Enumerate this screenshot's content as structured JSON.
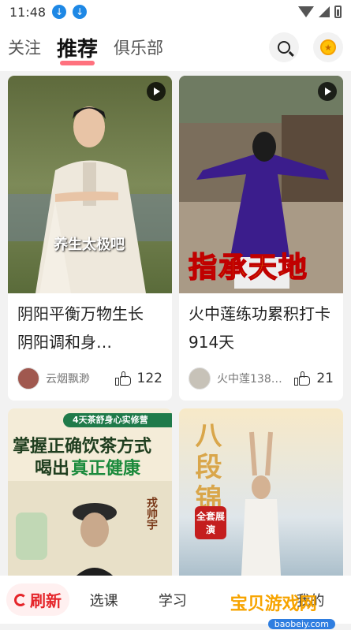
{
  "status_bar": {
    "time": "11:48"
  },
  "header": {
    "tabs": [
      {
        "label": "关注"
      },
      {
        "label": "推荐"
      },
      {
        "label": "俱乐部"
      }
    ]
  },
  "feed": {
    "cards": [
      {
        "title": "阴阳平衡万物生长 阴阳调和身…",
        "overlay": "养生太极吧",
        "author": "云烟飘渺",
        "likes": "122"
      },
      {
        "title": "火中莲练功累积打卡914天",
        "overlay": "指承天地",
        "author": "火中莲138…",
        "likes": "21"
      },
      {
        "overlay_top": "4天茶舒身心实修营",
        "overlay_line1": "掌握正确饮茶方式",
        "overlay_line2a": "喝出",
        "overlay_line2b": "真正健康",
        "overlay_name": "戎帅宇"
      },
      {
        "overlay_big": "八段锦",
        "overlay_badge": "全套展演"
      }
    ]
  },
  "bottom_nav": {
    "refresh": "刷新",
    "courses": "选课",
    "study": "学习",
    "mine": "我的"
  },
  "watermark": {
    "main": "宝贝游戏网",
    "sub": "baobeiy.com"
  },
  "colors": {
    "accent": "#e5252a",
    "download_icon": "#1e88e5"
  }
}
